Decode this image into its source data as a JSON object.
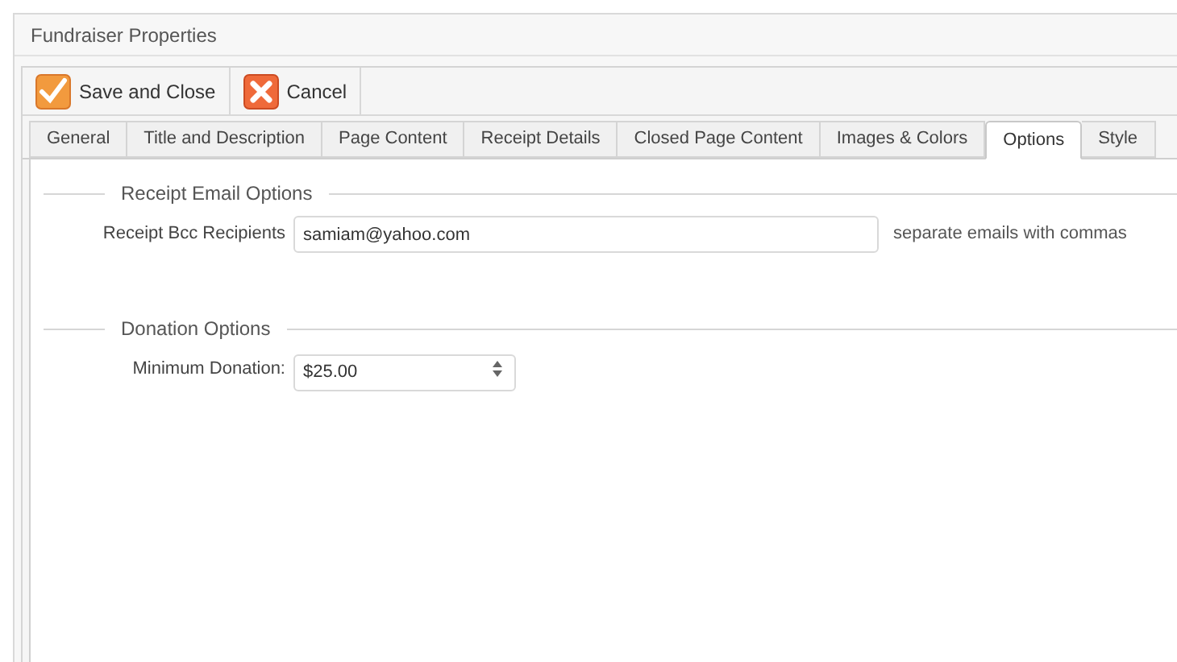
{
  "window": {
    "title": "Fundraiser Properties"
  },
  "toolbar": [
    {
      "kind": "save",
      "label": "Save and Close"
    },
    {
      "kind": "cancel",
      "label": "Cancel"
    }
  ],
  "tabs": [
    {
      "label": "General",
      "selected": false
    },
    {
      "label": "Title and Description",
      "selected": false
    },
    {
      "label": "Page Content",
      "selected": false
    },
    {
      "label": "Receipt Details",
      "selected": false
    },
    {
      "label": "Closed Page Content",
      "selected": false
    },
    {
      "label": "Images & Colors",
      "selected": false
    },
    {
      "label": "Options",
      "selected": true
    },
    {
      "label": "Style",
      "selected": false
    }
  ],
  "sections": [
    {
      "legend": "Receipt Email Options",
      "fields": [
        {
          "kind": "text",
          "label": "Receipt Bcc Recipients",
          "value": "samiam@yahoo.com",
          "hint": "separate emails with commas"
        }
      ]
    },
    {
      "legend": "Donation Options",
      "fields": [
        {
          "kind": "spinner",
          "label": "Minimum Donation:",
          "value": "$25.00"
        }
      ]
    }
  ]
}
